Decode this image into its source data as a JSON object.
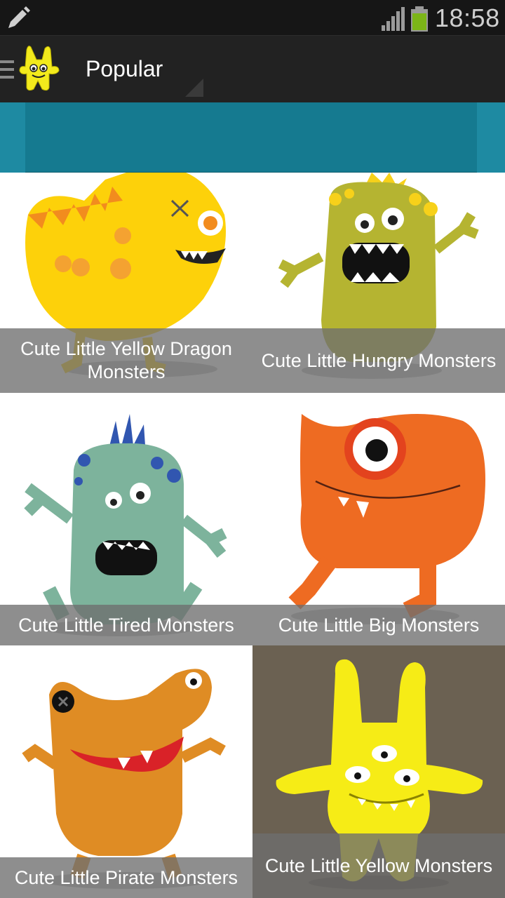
{
  "status_bar": {
    "time": "18:58"
  },
  "action_bar": {
    "title": "Popular"
  },
  "grid": {
    "items": [
      {
        "label": "Cute Little Yellow Dragon Monsters"
      },
      {
        "label": "Cute Little Hungry Monsters"
      },
      {
        "label": "Cute Little Tired Monsters"
      },
      {
        "label": "Cute Little Big Monsters"
      },
      {
        "label": "Cute Little Pirate Monsters"
      },
      {
        "label": "Cute Little Yellow Monsters"
      }
    ]
  },
  "colors": {
    "status_bar": "#161616",
    "action_bar": "#222222",
    "banner": "#1e8aa2",
    "caption_overlay": "#6e6e6e",
    "battery": "#7cb518"
  }
}
